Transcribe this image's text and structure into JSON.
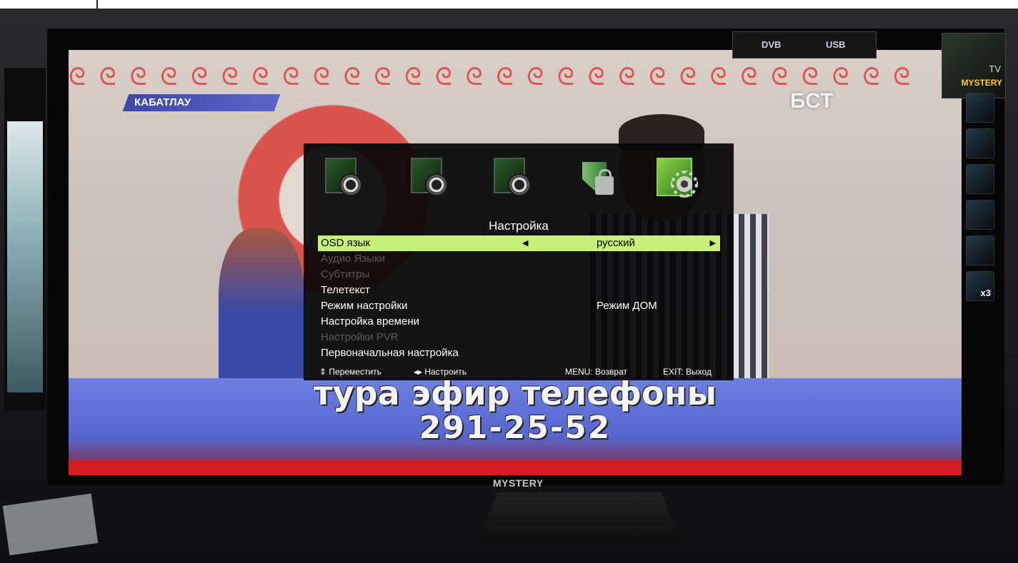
{
  "channel": {
    "tag": "КАБАТЛАУ",
    "logo": "БСТ"
  },
  "ticker": {
    "line1": "тура эфир телефоны",
    "line2": "291-25-52"
  },
  "tv": {
    "brand": "MYSTERY",
    "sticker_dvb": "DVB",
    "sticker_usb": "USB",
    "box_tv": "TV",
    "box_brand": "MYSTERY",
    "hdmi_count": "x3"
  },
  "osd": {
    "title": "Настройка",
    "icons": [
      "picture-icon",
      "sound-icon",
      "channel-icon",
      "lock-icon",
      "setup-icon"
    ],
    "selected_icon": "setup-icon",
    "accent_color": "#c6f07a",
    "items": [
      {
        "label": "OSD язык",
        "value": "русский",
        "selected": true,
        "enabled": true
      },
      {
        "label": "Аудио Языки",
        "value": "",
        "selected": false,
        "enabled": false
      },
      {
        "label": "Субтитры",
        "value": "",
        "selected": false,
        "enabled": false
      },
      {
        "label": "Телетекст",
        "value": "",
        "selected": false,
        "enabled": true
      },
      {
        "label": "Режим настройки",
        "value": "Режим ДОМ",
        "selected": false,
        "enabled": true
      },
      {
        "label": "Настройка времени",
        "value": "",
        "selected": false,
        "enabled": true
      },
      {
        "label": "Настройки PVR",
        "value": "",
        "selected": false,
        "enabled": false
      },
      {
        "label": "Первоначальная настройка",
        "value": "",
        "selected": false,
        "enabled": true
      }
    ],
    "hints": {
      "move": "⇕ Переместить",
      "adjust": "◂▸ Настроить",
      "menu": "MENU: Возврат",
      "exit": "EXIT: Выход"
    }
  }
}
